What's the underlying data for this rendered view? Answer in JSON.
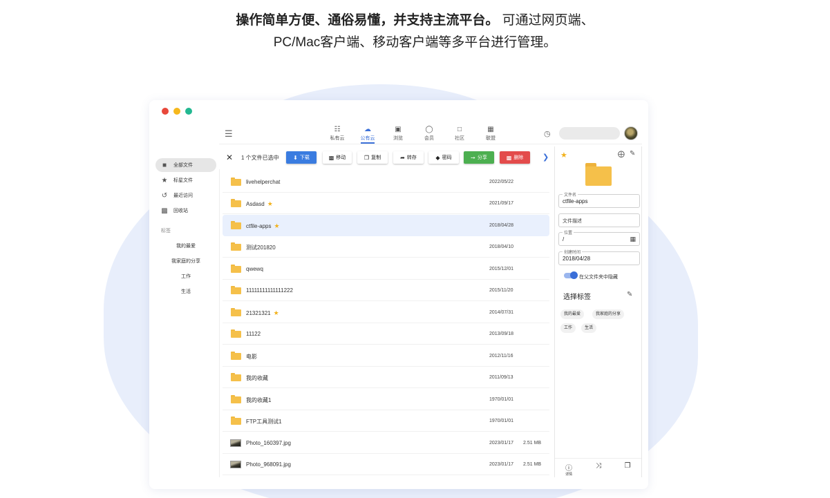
{
  "headline": {
    "line1_bold": "操作简单方便、通俗易懂，并支持主流平台。",
    "line1_rest": " 可通过网页端、",
    "line2": "PC/Mac客户端、移动客户端等多平台进行管理。"
  },
  "colors": {
    "accent": "#3a6fd8",
    "dot_red": "#e8483b",
    "dot_yellow": "#f6b81d",
    "dot_green": "#23b891",
    "star": "#f2b21d",
    "folder": "#f5c04a"
  },
  "sidebar": {
    "items": [
      {
        "label": "全部文件",
        "icon": "folder-icon"
      },
      {
        "label": "标星文件",
        "icon": "star-icon"
      },
      {
        "label": "最近访问",
        "icon": "history-icon"
      },
      {
        "label": "回收站",
        "icon": "trash-icon"
      }
    ],
    "tags_header": "标签",
    "tags": [
      "我的最爱",
      "我家庭的分享",
      "工作",
      "生活"
    ]
  },
  "nav": [
    {
      "label": "私有云",
      "icon": "database-icon"
    },
    {
      "label": "公有云",
      "icon": "cloud-icon"
    },
    {
      "label": "浏览",
      "icon": "browse-icon"
    },
    {
      "label": "会员",
      "icon": "member-icon"
    },
    {
      "label": "社区",
      "icon": "community-icon"
    },
    {
      "label": "联盟",
      "icon": "alliance-icon"
    }
  ],
  "actionbar": {
    "selection": "1 个文件已选中",
    "buttons": [
      "下载",
      "移动",
      "复制",
      "转存",
      "密码",
      "分享",
      "删除"
    ]
  },
  "files": [
    {
      "name": "livehelperchat",
      "date": "2022/05/22",
      "size": "",
      "starred": false
    },
    {
      "name": "Asdasd",
      "date": "2021/09/17",
      "size": "",
      "starred": true
    },
    {
      "name": "ctfile-apps",
      "date": "2018/04/28",
      "size": "",
      "starred": true
    },
    {
      "name": "测试201820",
      "date": "2018/04/10",
      "size": "",
      "starred": false
    },
    {
      "name": "qwewq",
      "date": "2015/12/01",
      "size": "",
      "starred": false
    },
    {
      "name": "11111111111111222",
      "date": "2015/11/20",
      "size": "",
      "starred": false
    },
    {
      "name": "21321321",
      "date": "2014/07/31",
      "size": "",
      "starred": true
    },
    {
      "name": "11122",
      "date": "2013/09/18",
      "size": "",
      "starred": false
    },
    {
      "name": "电影",
      "date": "2012/11/16",
      "size": "",
      "starred": false
    },
    {
      "name": "我的收藏",
      "date": "2011/09/13",
      "size": "",
      "starred": false
    },
    {
      "name": "我的收藏1",
      "date": "1970/01/01",
      "size": "",
      "starred": false
    },
    {
      "name": "FTP工具测试1",
      "date": "1970/01/01",
      "size": "",
      "starred": false
    },
    {
      "name": "Photo_160397.jpg",
      "date": "2023/01/17",
      "size": "2.51 MB",
      "starred": false
    },
    {
      "name": "Photo_968091.jpg",
      "date": "2023/01/17",
      "size": "2.51 MB",
      "starred": false
    }
  ],
  "detail": {
    "filename_label": "文件名",
    "filename": "ctfile-apps",
    "desc_placeholder": "文件描述",
    "location_label": "位置",
    "location": "/",
    "created_label": "创建时间",
    "created": "2018/04/28",
    "hide_toggle_label": "在父文件夹中隐藏",
    "tags_title": "选择标签",
    "tags": [
      "我的最爱",
      "我家庭的分享",
      "工作",
      "生活"
    ],
    "footer_info_label": "详情"
  }
}
